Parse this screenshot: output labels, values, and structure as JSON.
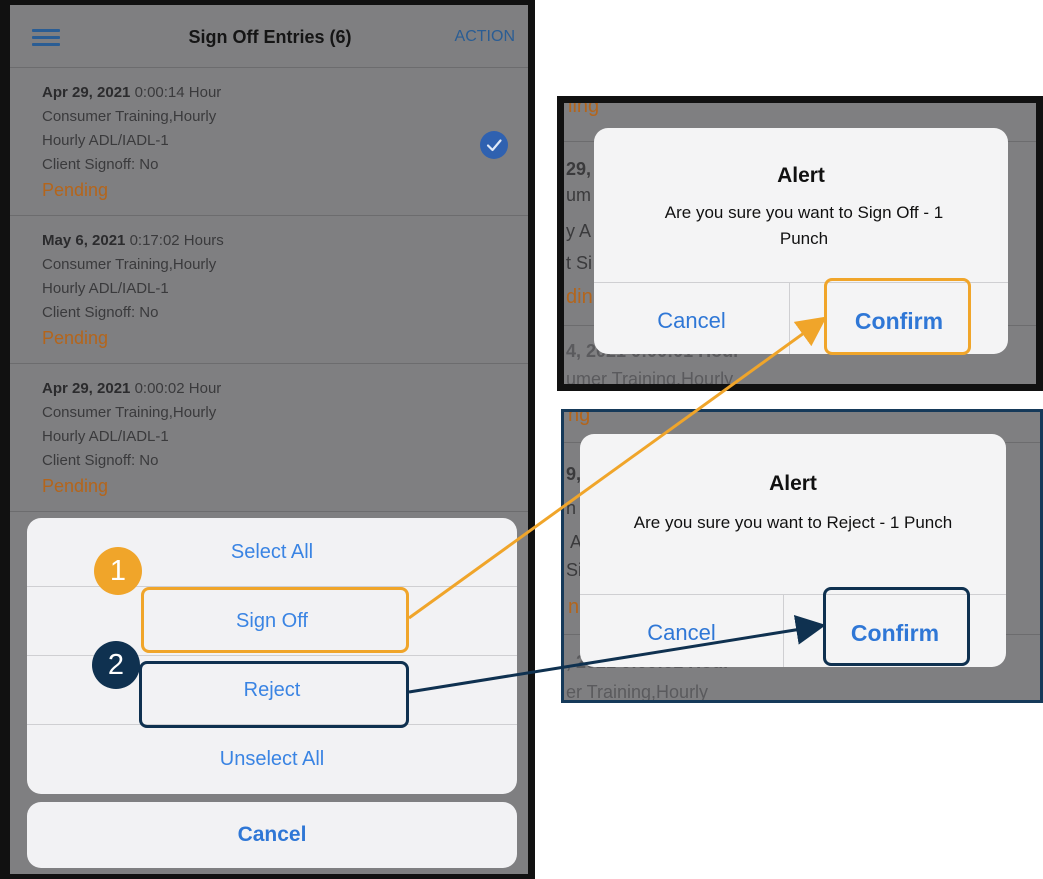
{
  "header": {
    "title": "Sign Off Entries (6)",
    "action": "ACTION"
  },
  "entries": [
    {
      "date": "Apr 29, 2021",
      "duration": "0:00:14 Hour",
      "service": "Consumer Training,Hourly",
      "activity": "Hourly ADL/IADL-1",
      "signoff": "Client Signoff: No",
      "status": "Pending",
      "selected": true
    },
    {
      "date": "May 6, 2021",
      "duration": "0:17:02 Hours",
      "service": "Consumer Training,Hourly",
      "activity": "Hourly ADL/IADL-1",
      "signoff": "Client Signoff: No",
      "status": "Pending",
      "selected": false
    },
    {
      "date": "Apr 29, 2021",
      "duration": "0:00:02 Hour",
      "service": "Consumer Training,Hourly",
      "activity": "Hourly ADL/IADL-1",
      "signoff": "Client Signoff: No",
      "status": "Pending",
      "selected": false
    }
  ],
  "action_sheet": {
    "select_all": "Select All",
    "sign_off": "Sign Off",
    "reject": "Reject",
    "unselect_all": "Unselect All",
    "cancel": "Cancel"
  },
  "callouts": {
    "step1": "1",
    "step2": "2"
  },
  "stray_text": "n",
  "dialog_signoff": {
    "title": "Alert",
    "message": "Are you sure you want to Sign Off - 1 Punch",
    "cancel": "Cancel",
    "confirm": "Confirm",
    "bg_fragments": [
      "ling",
      "29,",
      "um",
      "y A",
      "t Si",
      "din",
      "4, 2021 0:00:01 Hour",
      "umer Training,Hourly"
    ]
  },
  "dialog_reject": {
    "title": "Alert",
    "message": "Are you sure you want to Reject - 1 Punch",
    "cancel": "Cancel",
    "confirm": "Confirm",
    "bg_fragments": [
      "ng",
      "9,",
      "n",
      "A",
      "Si",
      "n",
      ", 2021 0:00:01 Hour",
      "er Training,Hourly"
    ]
  },
  "colors": {
    "accent_orange": "#f0a52a",
    "accent_navy": "#0f3150",
    "ios_blue": "#2f77d6",
    "pending_orange": "#b4651b"
  }
}
